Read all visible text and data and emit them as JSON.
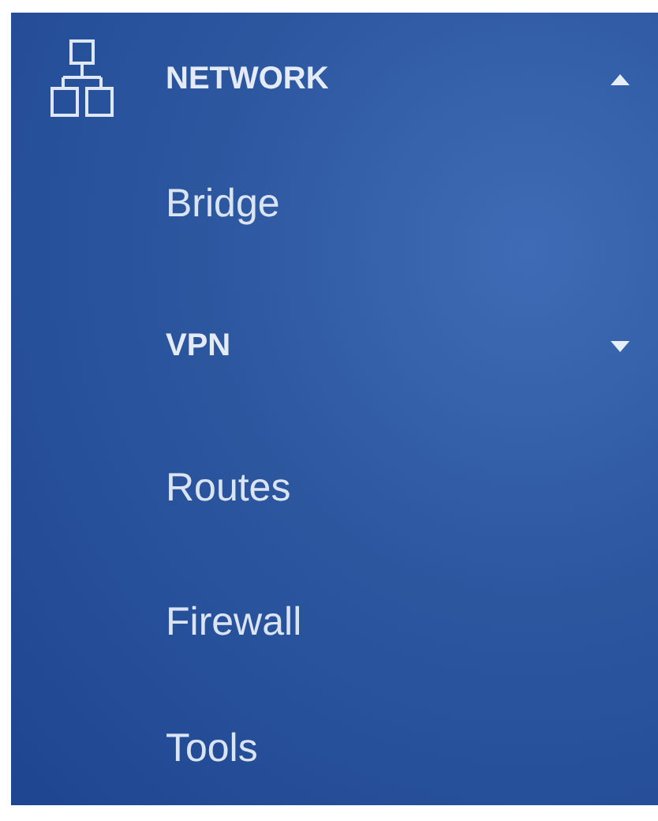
{
  "menu": {
    "title": "NETWORK",
    "expanded": true,
    "items": [
      {
        "kind": "link",
        "label": "Bridge"
      },
      {
        "kind": "group",
        "label": "VPN",
        "expanded": false
      },
      {
        "kind": "link",
        "label": "Routes"
      },
      {
        "kind": "link",
        "label": "Firewall"
      },
      {
        "kind": "link",
        "label": "Tools"
      }
    ]
  }
}
